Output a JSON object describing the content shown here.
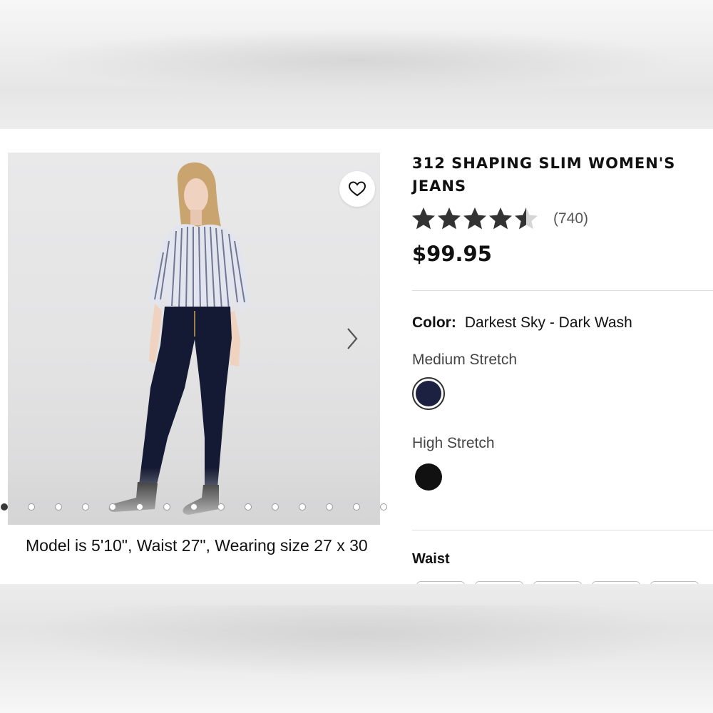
{
  "product": {
    "title": "312 SHAPING SLIM WOMEN'S JEANS",
    "rating": 4.5,
    "rating_max": 5,
    "review_count": "(740)",
    "price": "$99.95"
  },
  "gallery": {
    "favorite_icon": "heart-outline-icon",
    "next_icon": "chevron-right-icon",
    "slide_count": 15,
    "active_slide": 1,
    "caption": "Model is 5'10\", Waist 27\", Wearing size 27 x 30"
  },
  "color": {
    "label": "Color:",
    "value": "Darkest Sky - Dark Wash",
    "groups": [
      {
        "label": "Medium Stretch",
        "swatch_color": "#1c2142",
        "selected": true
      },
      {
        "label": "High Stretch",
        "swatch_color": "#111111",
        "selected": false
      }
    ]
  },
  "waist": {
    "label": "Waist"
  },
  "colors": {
    "star_filled": "#333333",
    "star_empty": "#d6d6d6",
    "divider": "#dcdcdc"
  }
}
